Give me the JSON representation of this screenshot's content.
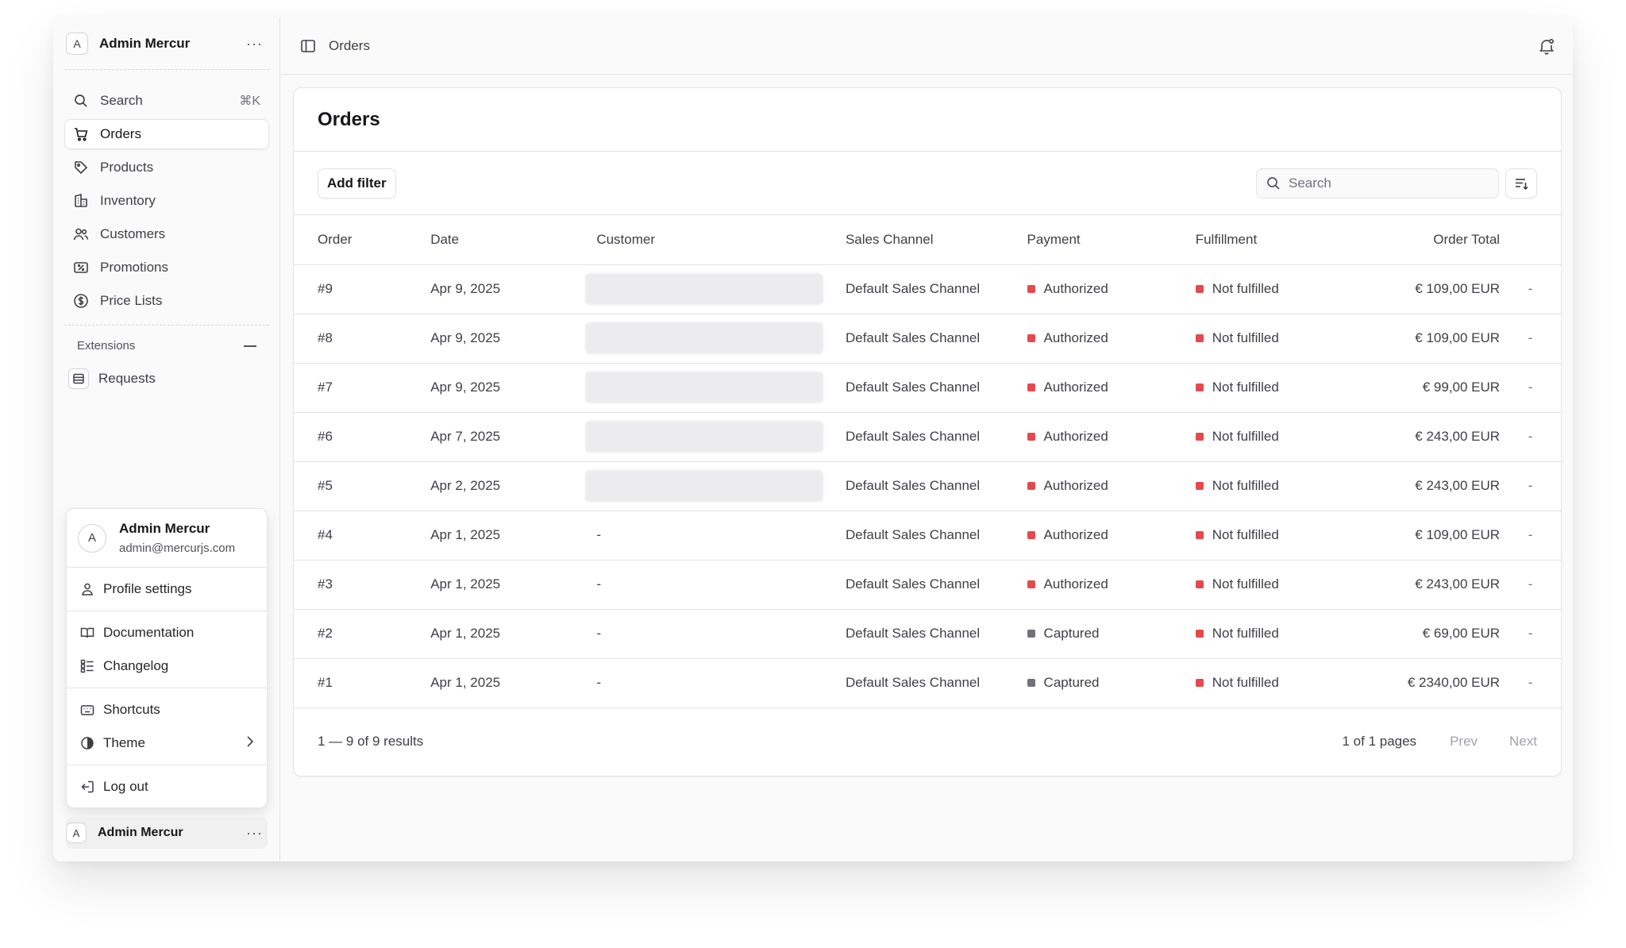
{
  "user": {
    "initial": "A",
    "name": "Admin Mercur",
    "email": "admin@mercurjs.com"
  },
  "sidebar": {
    "more_glyph": "···",
    "search": {
      "label": "Search",
      "shortcut": "⌘K",
      "icon": "search-icon"
    },
    "items": [
      {
        "label": "Orders",
        "icon": "cart-icon",
        "active": true
      },
      {
        "label": "Products",
        "icon": "tag-icon"
      },
      {
        "label": "Inventory",
        "icon": "building-icon"
      },
      {
        "label": "Customers",
        "icon": "users-icon"
      },
      {
        "label": "Promotions",
        "icon": "receipt-icon"
      },
      {
        "label": "Price Lists",
        "icon": "currency-icon"
      }
    ],
    "extensions": {
      "heading": "Extensions",
      "items": [
        {
          "label": "Requests",
          "icon": "list-icon"
        }
      ]
    }
  },
  "user_menu": {
    "profile_settings": "Profile settings",
    "documentation": "Documentation",
    "changelog": "Changelog",
    "shortcuts": "Shortcuts",
    "theme": "Theme",
    "logout": "Log out"
  },
  "topbar": {
    "breadcrumb": "Orders"
  },
  "page": {
    "title": "Orders",
    "add_filter": "Add filter",
    "search_placeholder": "Search"
  },
  "table": {
    "headers": {
      "order": "Order",
      "date": "Date",
      "customer": "Customer",
      "channel": "Sales Channel",
      "payment": "Payment",
      "fulfillment": "Fulfillment",
      "total": "Order Total"
    },
    "rows": [
      {
        "order": "#9",
        "date": "Apr 9, 2025",
        "customer": "",
        "customer_blurred": true,
        "channel": "Default Sales Channel",
        "payment": "Authorized",
        "fulfillment": "Not fulfilled",
        "total": "€ 109,00 EUR",
        "extra": "-"
      },
      {
        "order": "#8",
        "date": "Apr 9, 2025",
        "customer": "",
        "customer_blurred": true,
        "channel": "Default Sales Channel",
        "payment": "Authorized",
        "fulfillment": "Not fulfilled",
        "total": "€ 109,00 EUR",
        "extra": "-"
      },
      {
        "order": "#7",
        "date": "Apr 9, 2025",
        "customer": "",
        "customer_blurred": true,
        "channel": "Default Sales Channel",
        "payment": "Authorized",
        "fulfillment": "Not fulfilled",
        "total": "€ 99,00 EUR",
        "extra": "-"
      },
      {
        "order": "#6",
        "date": "Apr 7, 2025",
        "customer": "",
        "customer_blurred": true,
        "channel": "Default Sales Channel",
        "payment": "Authorized",
        "fulfillment": "Not fulfilled",
        "total": "€ 243,00 EUR",
        "extra": "-"
      },
      {
        "order": "#5",
        "date": "Apr 2, 2025",
        "customer": "",
        "customer_blurred": true,
        "channel": "Default Sales Channel",
        "payment": "Authorized",
        "fulfillment": "Not fulfilled",
        "total": "€ 243,00 EUR",
        "extra": "-"
      },
      {
        "order": "#4",
        "date": "Apr 1, 2025",
        "customer": "-",
        "customer_blurred": false,
        "channel": "Default Sales Channel",
        "payment": "Authorized",
        "fulfillment": "Not fulfilled",
        "total": "€ 109,00 EUR",
        "extra": "-"
      },
      {
        "order": "#3",
        "date": "Apr 1, 2025",
        "customer": "-",
        "customer_blurred": false,
        "channel": "Default Sales Channel",
        "payment": "Authorized",
        "fulfillment": "Not fulfilled",
        "total": "€ 243,00 EUR",
        "extra": "-"
      },
      {
        "order": "#2",
        "date": "Apr 1, 2025",
        "customer": "-",
        "customer_blurred": false,
        "channel": "Default Sales Channel",
        "payment": "Captured",
        "fulfillment": "Not fulfilled",
        "total": "€ 69,00 EUR",
        "extra": "-"
      },
      {
        "order": "#1",
        "date": "Apr 1, 2025",
        "customer": "-",
        "customer_blurred": false,
        "channel": "Default Sales Channel",
        "payment": "Captured",
        "fulfillment": "Not fulfilled",
        "total": "€ 2340,00 EUR",
        "extra": "-"
      }
    ]
  },
  "pagination": {
    "results": "1 — 9 of 9 results",
    "pages": "1 of 1 pages",
    "prev": "Prev",
    "next": "Next"
  },
  "colors": {
    "authorized": "#e5484d",
    "captured": "#71717a",
    "not_fulfilled": "#e5484d"
  }
}
